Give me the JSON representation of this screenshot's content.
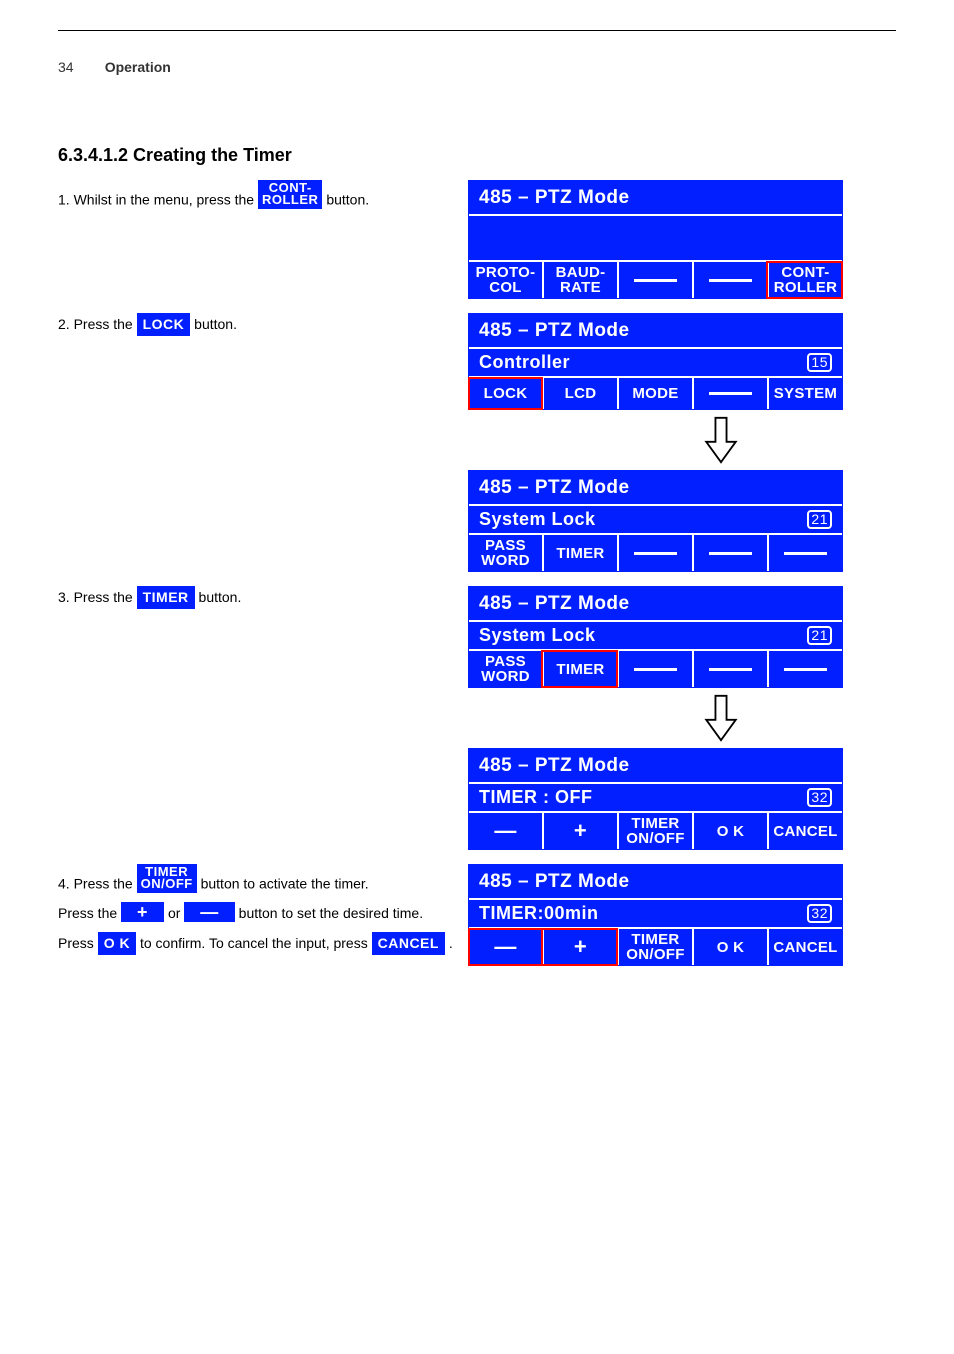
{
  "page": {
    "number": "34",
    "title": "Operation"
  },
  "section_title": "6.3.4.1.2 Creating the Timer",
  "step1": {
    "pre": "1. Whilst in the menu, press the ",
    "btn_l1": "CONT-",
    "btn_l2": "ROLLER",
    "mid": " button."
  },
  "step2": {
    "pre": "2. Press the ",
    "btn": "LOCK",
    "post": " button."
  },
  "step3": {
    "pre": "3. Press the ",
    "btn": "TIMER",
    "post": " button."
  },
  "step4_a": {
    "pre": "4. Press the ",
    "btn_l1": "TIMER",
    "btn_l2": "ON/OFF",
    "post": " button to activate the timer."
  },
  "step4_b": {
    "pre": "Press the ",
    "btn_plus": "+",
    "mid": " or ",
    "btn_minus": "—",
    "post": " button to set the desired time."
  },
  "step4_c": {
    "pre": "Press ",
    "btn_ok": "O K",
    "mid": " to confirm. To cancel the input, press ",
    "btn_cancel": "CANCEL",
    "post": "."
  },
  "screens": {
    "s1": {
      "title": "485 – PTZ Mode",
      "tabs": [
        {
          "l1": "PROTO-",
          "l2": "COL"
        },
        {
          "l1": "BAUD-",
          "l2": "RATE"
        },
        {
          "empty": true
        },
        {
          "empty": true
        },
        {
          "l1": "CONT-",
          "l2": "ROLLER",
          "red": true
        }
      ]
    },
    "s2": {
      "title": "485 – PTZ Mode",
      "sub": "Controller",
      "scroll": "15",
      "tabs": [
        {
          "l1": "LOCK",
          "red": true
        },
        {
          "l1": "LCD"
        },
        {
          "l1": "MODE"
        },
        {
          "empty": true
        },
        {
          "l1": "SYSTEM"
        }
      ]
    },
    "s3": {
      "title": "485 – PTZ Mode",
      "sub": "System Lock",
      "scroll": "21",
      "tabs": [
        {
          "l1": "PASS",
          "l2": "WORD"
        },
        {
          "l1": "TIMER"
        },
        {
          "empty": true
        },
        {
          "empty": true
        },
        {
          "empty": true
        }
      ]
    },
    "s4": {
      "title": "485 – PTZ Mode",
      "sub": "System Lock",
      "scroll": "21",
      "tabs": [
        {
          "l1": "PASS",
          "l2": "WORD"
        },
        {
          "l1": "TIMER",
          "red": true
        },
        {
          "empty": true
        },
        {
          "empty": true
        },
        {
          "empty": true
        }
      ]
    },
    "s5": {
      "title": "485 – PTZ Mode",
      "sub": "TIMER : OFF",
      "scroll": "32",
      "tabs": [
        {
          "big": "—"
        },
        {
          "big": "+"
        },
        {
          "l1": "TIMER",
          "l2": "ON/OFF"
        },
        {
          "l1": "O K"
        },
        {
          "l1": "CANCEL"
        }
      ]
    },
    "s6": {
      "title": "485 – PTZ Mode",
      "sub": "TIMER:00min",
      "scroll": "32",
      "tabs": [
        {
          "big": "—",
          "red": true
        },
        {
          "big": "+",
          "red": true
        },
        {
          "l1": "TIMER",
          "l2": "ON/OFF"
        },
        {
          "l1": "O K"
        },
        {
          "l1": "CANCEL"
        }
      ]
    }
  }
}
